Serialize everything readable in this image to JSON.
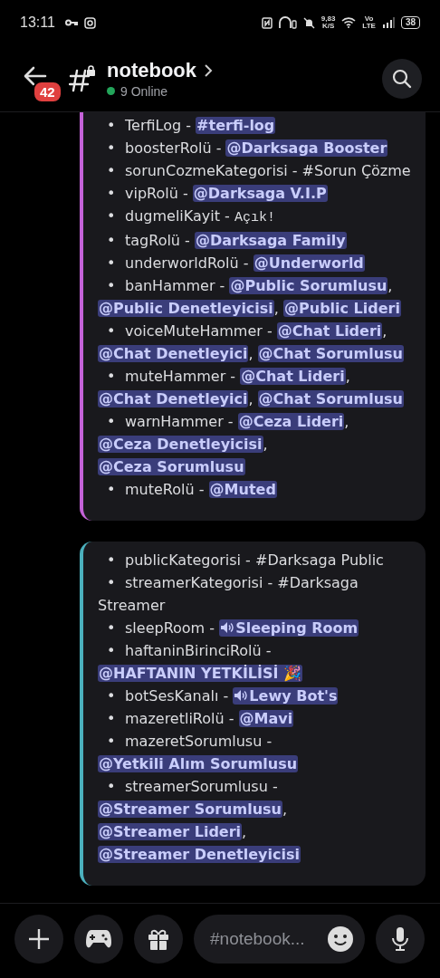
{
  "status_bar": {
    "time": "13:11",
    "net_speed": "9,83",
    "net_unit": "K/S",
    "volte_top": "Vo",
    "volte_bottom": "LTE",
    "battery": "38"
  },
  "header": {
    "badge": "42",
    "channel": "notebook",
    "online": "9 Online"
  },
  "cards": [
    {
      "color": "#c462d8",
      "items": [
        {
          "bullet": "•",
          "parts": [
            {
              "kind": "text",
              "text": "TerfiLog - "
            },
            {
              "kind": "channel",
              "text": "#terfi-log"
            }
          ]
        },
        {
          "bullet": "•",
          "parts": [
            {
              "kind": "text",
              "text": "boosterRolü - "
            },
            {
              "kind": "mention",
              "text": "@Darksaga Booster"
            }
          ]
        },
        {
          "bullet": "•",
          "parts": [
            {
              "kind": "text",
              "text": "sorunCozmeKategorisi - #Sorun Çözme"
            }
          ]
        },
        {
          "bullet": "•",
          "parts": [
            {
              "kind": "text",
              "text": "vipRolü - "
            },
            {
              "kind": "mention",
              "text": "@Darksaga V.I.P"
            }
          ]
        },
        {
          "bullet": "•",
          "parts": [
            {
              "kind": "text",
              "text": "dugmeliKayit - "
            },
            {
              "kind": "code",
              "text": "Açık!"
            }
          ]
        },
        {
          "bullet": "•",
          "parts": [
            {
              "kind": "text",
              "text": "tagRolü - "
            },
            {
              "kind": "mention",
              "text": "@Darksaga Family"
            }
          ]
        },
        {
          "bullet": "•",
          "parts": [
            {
              "kind": "text",
              "text": "underworldRolü - "
            },
            {
              "kind": "mention",
              "text": "@Underworld"
            }
          ]
        },
        {
          "bullet": "•",
          "parts": [
            {
              "kind": "text",
              "text": "banHammer - "
            },
            {
              "kind": "mention",
              "text": "@Public Sorumlusu"
            },
            {
              "kind": "text",
              "text": ", "
            },
            {
              "kind": "mention",
              "text": "@Public Denetleyicisi"
            },
            {
              "kind": "text",
              "text": ", "
            },
            {
              "kind": "mention",
              "text": "@Public Lideri"
            }
          ]
        },
        {
          "bullet": "•",
          "parts": [
            {
              "kind": "text",
              "text": "voiceMuteHammer - "
            },
            {
              "kind": "mention",
              "text": "@Chat Lideri"
            },
            {
              "kind": "text",
              "text": ", "
            },
            {
              "kind": "mention",
              "text": "@Chat Denetleyici"
            },
            {
              "kind": "text",
              "text": ", "
            },
            {
              "kind": "mention",
              "text": "@Chat Sorumlusu"
            }
          ]
        },
        {
          "bullet": "•",
          "parts": [
            {
              "kind": "text",
              "text": "muteHammer - "
            },
            {
              "kind": "mention",
              "text": "@Chat Lideri"
            },
            {
              "kind": "text",
              "text": ", "
            },
            {
              "kind": "mention",
              "text": "@Chat Denetleyici"
            },
            {
              "kind": "text",
              "text": ", "
            },
            {
              "kind": "mention",
              "text": "@Chat Sorumlusu"
            }
          ]
        },
        {
          "bullet": "•",
          "parts": [
            {
              "kind": "text",
              "text": "warnHammer - "
            },
            {
              "kind": "mention",
              "text": "@Ceza Lideri"
            },
            {
              "kind": "text",
              "text": ", "
            },
            {
              "kind": "mention",
              "text": "@Ceza Denetleyicisi"
            },
            {
              "kind": "text",
              "text": ", "
            },
            {
              "kind": "mention",
              "text": "@Ceza Sorumlusu"
            }
          ]
        },
        {
          "bullet": "•",
          "parts": [
            {
              "kind": "text",
              "text": "muteRolü - "
            },
            {
              "kind": "mention",
              "text": "@Muted"
            }
          ]
        }
      ]
    },
    {
      "color": "#4bb0bd",
      "items": [
        {
          "bullet": "•",
          "parts": [
            {
              "kind": "text",
              "text": "publicKategorisi - #Darksaga Public"
            }
          ]
        },
        {
          "bullet": "•",
          "parts": [
            {
              "kind": "text",
              "text": "streamerKategorisi - #Darksaga Streamer"
            }
          ]
        },
        {
          "bullet": "•",
          "parts": [
            {
              "kind": "text",
              "text": "sleepRoom - "
            },
            {
              "kind": "voice",
              "text": "Sleeping Room"
            }
          ]
        },
        {
          "bullet": "•",
          "parts": [
            {
              "kind": "text",
              "text": "haftaninBirinciRolü - "
            },
            {
              "kind": "mention",
              "text": "@HAFTANIN YETKİLİSİ 🎉"
            }
          ]
        },
        {
          "bullet": "•",
          "parts": [
            {
              "kind": "text",
              "text": "botSesKanalı - "
            },
            {
              "kind": "voice",
              "text": "Lewy Bot's"
            }
          ]
        },
        {
          "bullet": "•",
          "parts": [
            {
              "kind": "text",
              "text": "mazeretliRolü - "
            },
            {
              "kind": "mention",
              "text": "@Mavi"
            }
          ]
        },
        {
          "bullet": "•",
          "parts": [
            {
              "kind": "text",
              "text": "mazeretSorumlusu - "
            },
            {
              "kind": "mention",
              "text": "@Yetkili Alım Sorumlusu"
            }
          ]
        },
        {
          "bullet": "•",
          "parts": [
            {
              "kind": "text",
              "text": "streamerSorumlusu - "
            },
            {
              "kind": "mention",
              "text": "@Streamer Sorumlusu"
            },
            {
              "kind": "text",
              "text": ", "
            },
            {
              "kind": "mention",
              "text": "@Streamer Lideri"
            },
            {
              "kind": "text",
              "text": ", "
            },
            {
              "kind": "mention",
              "text": "@Streamer Denetleyicisi"
            }
          ]
        }
      ]
    }
  ],
  "composer": {
    "placeholder": "#notebook..."
  }
}
